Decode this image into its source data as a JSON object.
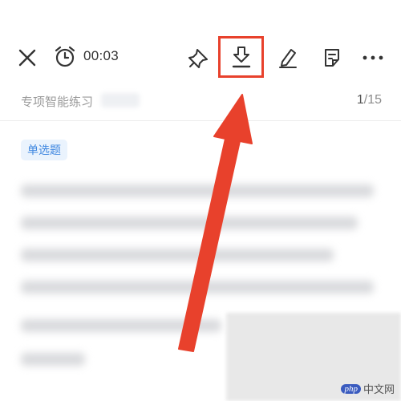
{
  "toolbar": {
    "timer": "00:03",
    "icons": [
      "close-icon",
      "alarm-clock-icon",
      "pin-icon",
      "download-icon",
      "edit-icon",
      "answer-sheet-icon",
      "more-icon"
    ]
  },
  "subheader": {
    "title": "专项智能练习",
    "page_current": "1",
    "page_total": "/15"
  },
  "question": {
    "type_tag": "单选题"
  },
  "annotation": {
    "highlight_color": "#e8412c",
    "arrow_color": "#e8412c"
  },
  "watermark": {
    "logo": "php",
    "text": "中文网"
  },
  "colors": {
    "tag_bg": "#eaf3fd",
    "tag_text": "#3f87e0",
    "divider": "#ececec"
  }
}
